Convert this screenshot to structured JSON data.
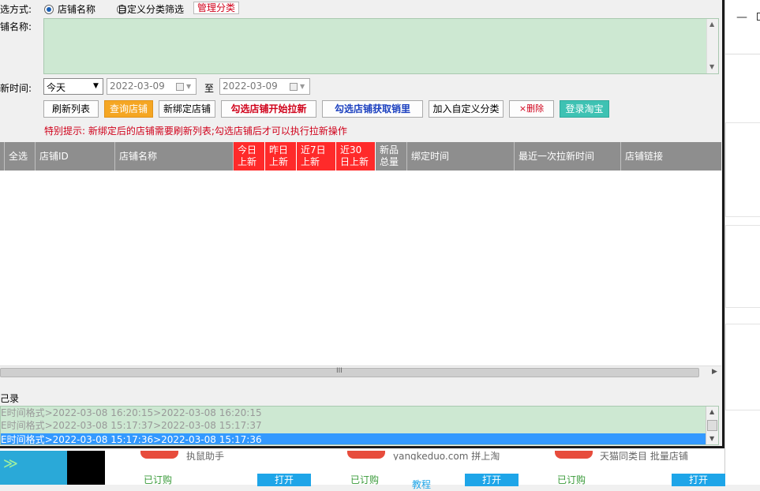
{
  "filter": {
    "label": "选方式:",
    "option_shop_name": "店铺名称",
    "option_custom": "自定义分类筛选",
    "manage_link": "管理分类"
  },
  "shop_name": {
    "label": "铺名称:"
  },
  "date": {
    "label": "新时间:",
    "range_selected": "今天",
    "start": "2022-03-09",
    "to": "至",
    "end": "2022-03-09"
  },
  "buttons": {
    "refresh_list": "刷新列表",
    "query_shop": "查询店铺",
    "new_bind": "新绑定店铺",
    "start_pull": "勾选店铺开始拉新",
    "get_sales": "勾选店铺获取销里",
    "add_custom": "加入自定义分类",
    "delete": "×删除",
    "login_taobao": "登录淘宝"
  },
  "tip": "特别提示: 新绑定后的店铺需要刷新列表;勾选店铺后才可以执行拉新操作",
  "table": {
    "headers": {
      "select_all": "全选",
      "shop_id": "店铺ID",
      "shop_name": "店铺名称",
      "today_1": "今日",
      "today_2": "上新",
      "yesterday_1": "昨日",
      "yesterday_2": "上新",
      "week_1": "近7日",
      "week_2": "上新",
      "month_1": "近30",
      "month_2": "日上新",
      "total_1": "新品",
      "total_2": "总量",
      "bind_time": "绑定时间",
      "last_pull": "最近一次拉新时间",
      "shop_link": "店铺链接"
    }
  },
  "scroll": {
    "grip": "III"
  },
  "log": {
    "label": "己录",
    "lines": [
      "E时间格式>2022-03-08 16:20:15>2022-03-08 16:20:15",
      "E时间格式>2022-03-08 15:17:37>2022-03-08 15:17:37",
      "E时间格式>2022-03-08 15:17:36>2022-03-08 15:17:36"
    ]
  },
  "background": {
    "card1_subtitle": "执鼠助手",
    "card1_status": "已订购",
    "card1_open": "打开",
    "card2_subtitle": "yangkeduo.com 拼上淘",
    "card2_status": "已订购",
    "card2_tutorial": "教程",
    "card2_open": "打开",
    "card3_subtitle": "天猫同类目 批量店铺",
    "card3_status": "已订购",
    "card3_open": "打开",
    "minimize": "—"
  },
  "colors": {
    "accent_orange": "#f5a623",
    "accent_teal": "#3ec2b3",
    "red_header": "#ff2a2a",
    "selection_blue": "#3399ff",
    "log_green": "#cde8d2"
  }
}
